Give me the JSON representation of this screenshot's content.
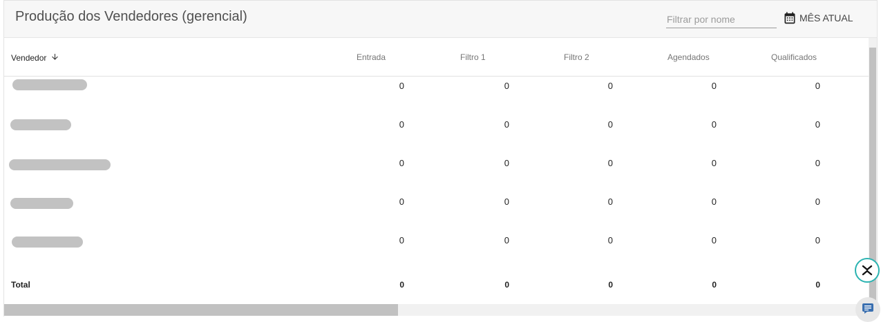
{
  "header": {
    "title": "Produção dos Vendedores (gerencial)",
    "filter_placeholder": "Filtrar por nome",
    "period_label": "MÊS ATUAL",
    "period_icon": "calendar-icon"
  },
  "table": {
    "columns": [
      "Vendedor",
      "Entrada",
      "Filtro 1",
      "Filtro 2",
      "Agendados",
      "Qualificados"
    ],
    "sort_icon": "arrow-down-icon",
    "rows": [
      {
        "values": [
          "0",
          "0",
          "0",
          "0",
          "0"
        ]
      },
      {
        "values": [
          "0",
          "0",
          "0",
          "0",
          "0"
        ]
      },
      {
        "values": [
          "0",
          "0",
          "0",
          "0",
          "0"
        ]
      },
      {
        "values": [
          "0",
          "0",
          "0",
          "0",
          "0"
        ]
      },
      {
        "values": [
          "0",
          "0",
          "0",
          "0",
          "0"
        ]
      }
    ],
    "total": {
      "label": "Total",
      "values": [
        "0",
        "0",
        "0",
        "0",
        "0"
      ]
    }
  },
  "widgets": {
    "collapse_icon": "collapse-chevrons-icon",
    "chat_icon": "chat-icon"
  }
}
